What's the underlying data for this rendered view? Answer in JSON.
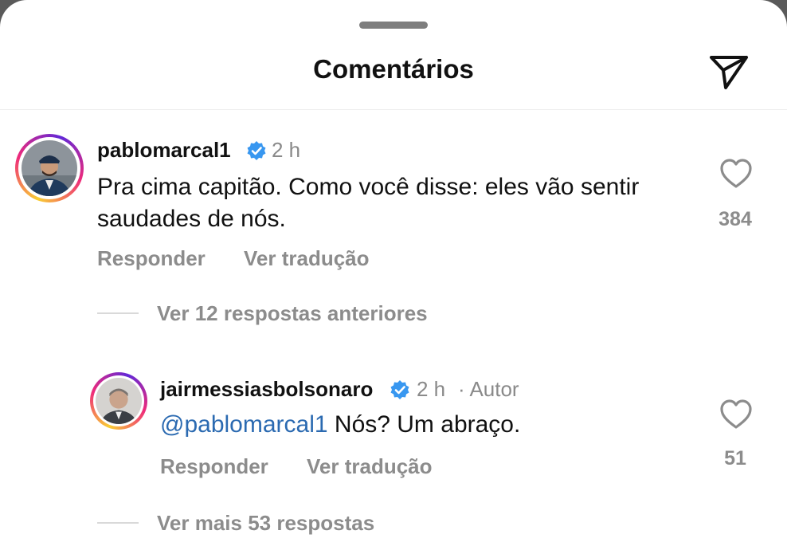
{
  "header": {
    "title": "Comentários",
    "share_icon": "send-icon"
  },
  "comments": [
    {
      "username": "pablomarcal1",
      "verified": true,
      "time": "2 h",
      "text": "Pra cima capitão. Como você disse: eles vão sentir saudades de nós.",
      "reply_label": "Responder",
      "translate_label": "Ver tradução",
      "likes": "384"
    }
  ],
  "earlier_replies_label": "Ver 12 respostas anteriores",
  "reply": {
    "username": "jairmessiasbolsonaro",
    "verified": true,
    "time": "2 h",
    "author_badge": "· Autor",
    "mention": "@pablomarcal1",
    "text": " Nós? Um abraço.",
    "reply_label": "Responder",
    "translate_label": "Ver tradução",
    "likes": "51"
  },
  "more_replies_label": "Ver mais 53 respostas",
  "colors": {
    "mention": "#2b6ab1",
    "verified": "#3897f0",
    "secondary_text": "#8c8c8c"
  }
}
